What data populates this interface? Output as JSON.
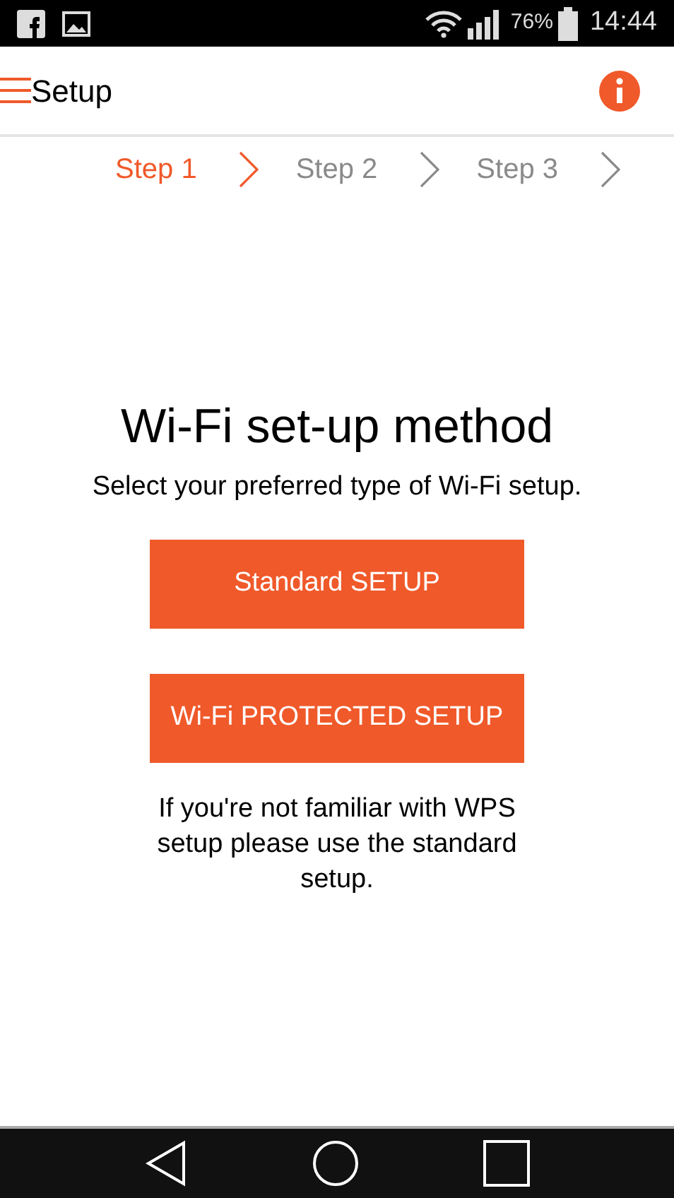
{
  "status_bar": {
    "battery": "76%",
    "time": "14:44"
  },
  "header": {
    "title": "Setup"
  },
  "steps": [
    {
      "label": "Step 1",
      "selected": true
    },
    {
      "label": "Step 2",
      "selected": false
    },
    {
      "label": "Step 3",
      "selected": false
    }
  ],
  "content": {
    "title": "Wi-Fi set-up method",
    "subtitle": "Select your preferred type of Wi-Fi setup.",
    "buttons": [
      "Standard SETUP",
      "Wi-Fi PROTECTED SETUP"
    ],
    "note": "If you're not familiar with WPS setup please use the standard setup."
  }
}
